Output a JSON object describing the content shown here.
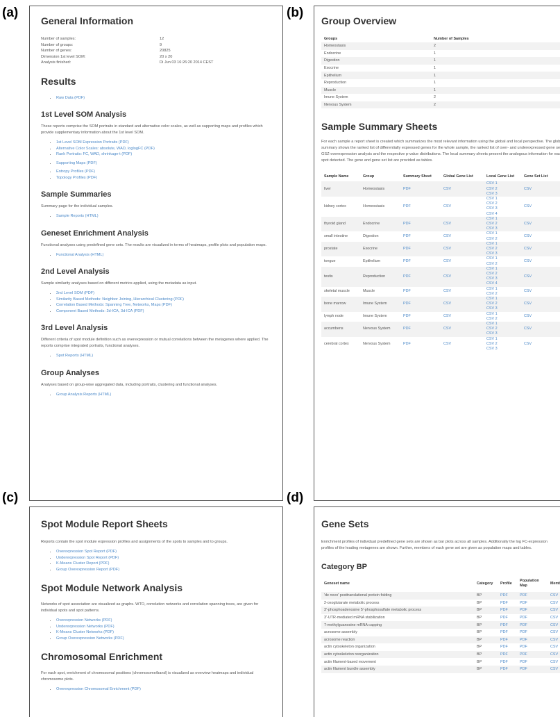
{
  "labels": {
    "a": "(a)",
    "b": "(b)",
    "c": "(c)",
    "d": "(d)"
  },
  "a": {
    "title": "General Information",
    "info": [
      {
        "k": "Number of samples:",
        "v": "12"
      },
      {
        "k": "Number of groups:",
        "v": "9"
      },
      {
        "k": "Number of genes:",
        "v": "20825"
      },
      {
        "k": "Dimension 1st level SOM:",
        "v": "20 x 20"
      },
      {
        "k": "Analysis finished:",
        "v": "Di Jun 03 16:26:20 2014 CEST"
      }
    ],
    "results_title": "Results",
    "raw": "Raw Data (PDF)",
    "som_title": "1st Level SOM Analysis",
    "som_text": "These reports comprise the SOM portraits in standard and alternative color scales, as well as supporting maps and profiles which provide supplementary information about the 1st level SOM.",
    "som_links1": [
      "1st Level SOM Expression Portraits (PDF)",
      "Alternative Color Scales: absolute, WAD, loglogFC (PDF)",
      "Rank Portraits: FC, WAD, shrinkage-t (PDF)"
    ],
    "som_links2": [
      "Supporting Maps (PDF)"
    ],
    "som_links3": [
      "Entropy Profiles (PDF)",
      "Topology Profiles (PDF)"
    ],
    "ss_title": "Sample Summaries",
    "ss_text": "Summary page for the individual samples.",
    "ss_links": [
      "Sample Reports (HTML)"
    ],
    "gea_title": "Geneset Enrichment Analysis",
    "gea_text": "Functional analyses using predefined gene sets. The results are visualized in terms of heatmaps, profile plots and population maps.",
    "gea_links": [
      "Functional Analysis (HTML)"
    ],
    "l2_title": "2nd Level Analysis",
    "l2_text": "Sample similarity analyses based on different metrics applied, using the metadata as input.",
    "l2_links": [
      "2nd Level SOM (PDF)",
      "Similarity Based Methods: Neighbor Joining, Hierarchical Clustering (PDF)",
      "Correlation Based Methods: Spanning Tree, Networks, Maps (PDF)",
      "Component Based Methods: 2d-ICA, 3d-ICA (PDF)"
    ],
    "l3_title": "3rd Level Analysis",
    "l3_text": "Different criteria of spot module definition such as overexpression or mutual correlations between the metagenes where applied. The reports comprise integrated portraits, functional analyses.",
    "l3_links": [
      "Spot Reports (HTML)"
    ],
    "ga_title": "Group Analyses",
    "ga_text": "Analyses based on group-wise aggregated data, including portraits, clustering and functional analyses.",
    "ga_links": [
      "Group Analysis Reports (HTML)"
    ]
  },
  "b": {
    "title": "Group Overview",
    "groups_headers": [
      "Groups",
      "Number of Samples"
    ],
    "groups": [
      [
        "Homeostasis",
        "2"
      ],
      [
        "Endocrine",
        "1"
      ],
      [
        "Digestion",
        "1"
      ],
      [
        "Exocrine",
        "1"
      ],
      [
        "Epithelium",
        "1"
      ],
      [
        "Reproduction",
        "1"
      ],
      [
        "Muscle",
        "1"
      ],
      [
        "Imune System",
        "2"
      ],
      [
        "Nervous System",
        "2"
      ]
    ],
    "sss_title": "Sample Summary Sheets",
    "sss_text": "For each sample a report sheet is created which summarizes the most relevant information using the global and local perspective. The global summary shows the ranked list of differentially expressed genes for the whole sample, the ranked list of over- and underexpressed gene sets after GSZ-overexpression analysis and the respective p-value distributions. The local summary sheets present the analogous information for each single spot detected. The gene and gene set list are provided as tables.",
    "sheet_headers": [
      "Sample Name",
      "Group",
      "Summary Sheet",
      "Global Gene List",
      "Local Gene List",
      "Gene Set List"
    ],
    "sheets": [
      {
        "name": "liver",
        "group": "Homeostasis",
        "summary": "PDF",
        "global": "CSV",
        "local": [
          "CSV 1",
          "CSV 2",
          "CSV 3"
        ],
        "geneset": "CSV"
      },
      {
        "name": "kidney cortex",
        "group": "Homeostasis",
        "summary": "PDF",
        "global": "CSV",
        "local": [
          "CSV 1",
          "CSV 2",
          "CSV 3",
          "CSV 4"
        ],
        "geneset": "CSV"
      },
      {
        "name": "thyroid gland",
        "group": "Endocrine",
        "summary": "PDF",
        "global": "CSV",
        "local": [
          "CSV 1",
          "CSV 2",
          "CSV 3"
        ],
        "geneset": "CSV"
      },
      {
        "name": "small intestine",
        "group": "Digestion",
        "summary": "PDF",
        "global": "CSV",
        "local": [
          "CSV 1",
          "CSV 2"
        ],
        "geneset": "CSV"
      },
      {
        "name": "prostate",
        "group": "Exocrine",
        "summary": "PDF",
        "global": "CSV",
        "local": [
          "CSV 1",
          "CSV 2",
          "CSV 3"
        ],
        "geneset": "CSV"
      },
      {
        "name": "tongue",
        "group": "Epithelium",
        "summary": "PDF",
        "global": "CSV",
        "local": [
          "CSV 1",
          "CSV 2"
        ],
        "geneset": "CSV"
      },
      {
        "name": "testis",
        "group": "Reproduction",
        "summary": "PDF",
        "global": "CSV",
        "local": [
          "CSV 1",
          "CSV 2",
          "CSV 3",
          "CSV 4"
        ],
        "geneset": "CSV"
      },
      {
        "name": "skeletal muscle",
        "group": "Muscle",
        "summary": "PDF",
        "global": "CSV",
        "local": [
          "CSV 1",
          "CSV 2"
        ],
        "geneset": "CSV"
      },
      {
        "name": "bone marrow",
        "group": "Imune System",
        "summary": "PDF",
        "global": "CSV",
        "local": [
          "CSV 1",
          "CSV 2",
          "CSV 3"
        ],
        "geneset": "CSV"
      },
      {
        "name": "lymph node",
        "group": "Imune System",
        "summary": "PDF",
        "global": "CSV",
        "local": [
          "CSV 1",
          "CSV 2"
        ],
        "geneset": "CSV"
      },
      {
        "name": "accumbens",
        "group": "Nervous System",
        "summary": "PDF",
        "global": "CSV",
        "local": [
          "CSV 1",
          "CSV 2",
          "CSV 3"
        ],
        "geneset": "CSV"
      },
      {
        "name": "cerebral cortex",
        "group": "Nervous System",
        "summary": "PDF",
        "global": "CSV",
        "local": [
          "CSV 1",
          "CSV 2",
          "CSV 3"
        ],
        "geneset": "CSV"
      }
    ]
  },
  "c": {
    "title": "Spot Module Report Sheets",
    "text": "Reports contain the spot module expression profiles and assignments of the spots to samples and to groups.",
    "links": [
      "Overexpression Spot Report (PDF)",
      "Underexpression Spot Report (PDF)",
      "K-Means Cluster Report (PDF)",
      "Group Overexpression Report (PDF)"
    ],
    "net_title": "Spot Module Network Analysis",
    "net_text": "Networks of spot association are visualized as graphs. WTO, correlation networks and correlation spanning trees, are given for individual spots and spot patterns.",
    "net_links": [
      "Overexpression Networks (PDF)",
      "Underexpression Networks (PDF)",
      "K-Means Cluster Networks (PDF)",
      "Group Overexpression Networks (PDF)"
    ],
    "chr_title": "Chromosomal Enrichment",
    "chr_text": "For each spot, enrichment of chromosomal positions (chromosome/band) is visualized as overview heatmaps and individual chromosome plots.",
    "chr_links": [
      "Overexpression Chromosomal Enrichment (PDF)"
    ]
  },
  "d": {
    "title": "Gene Sets",
    "text": "Enrichment profiles of individual predefined gene sets are shown as bar plots across all samples. Additionally the log FC-expression profiles of the leading metagenes are shown. Further, members of each gene set are given as population maps and tables.",
    "cat_title": "Category BP",
    "headers": [
      "Geneset name",
      "Category",
      "Profile",
      "Population Map",
      "Members"
    ],
    "rows": [
      [
        "'de novo' posttranslational protein folding",
        "BP",
        "PDF",
        "PDF",
        "CSV"
      ],
      [
        "2-oxoglutarate metabolic process",
        "BP",
        "PDF",
        "PDF",
        "CSV"
      ],
      [
        "3'-phosphoadenosine 5'-phosphosulfate metabolic process",
        "BP",
        "PDF",
        "PDF",
        "CSV"
      ],
      [
        "3'-UTR-mediated mRNA stabilization",
        "BP",
        "PDF",
        "PDF",
        "CSV"
      ],
      [
        "7-methylguanosine mRNA capping",
        "BP",
        "PDF",
        "PDF",
        "CSV"
      ],
      [
        "acrosome assembly",
        "BP",
        "PDF",
        "PDF",
        "CSV"
      ],
      [
        "acrosome reaction",
        "BP",
        "PDF",
        "PDF",
        "CSV"
      ],
      [
        "actin cytoskeleton organization",
        "BP",
        "PDF",
        "PDF",
        "CSV"
      ],
      [
        "actin cytoskeleton reorganization",
        "BP",
        "PDF",
        "PDF",
        "CSV"
      ],
      [
        "actin filament-based movement",
        "BP",
        "PDF",
        "PDF",
        "CSV"
      ],
      [
        "actin filament bundle assembly",
        "BP",
        "PDF",
        "PDF",
        "CSV"
      ]
    ]
  }
}
